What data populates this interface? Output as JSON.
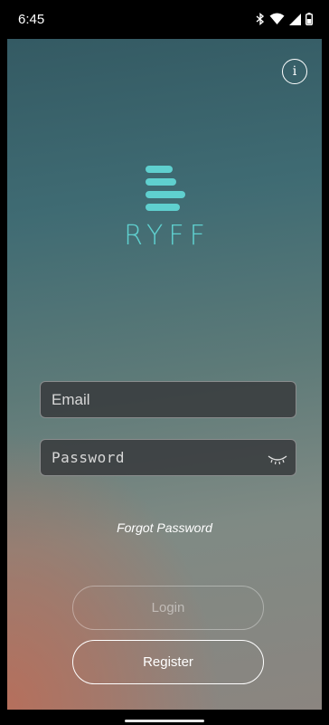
{
  "status_bar": {
    "time": "6:45",
    "icons": [
      "bluetooth-icon",
      "wifi-icon",
      "signal-icon",
      "battery-icon"
    ]
  },
  "app": {
    "name": "RYFF",
    "accent_color": "#5fd0cf"
  },
  "login_form": {
    "email_placeholder": "Email",
    "password_placeholder": "Password",
    "password_toggle_icon": "eye-closed-icon",
    "forgot_password": "Forgot Password",
    "login_label": "Login",
    "register_label": "Register"
  },
  "header": {
    "info_icon": "info-icon"
  }
}
